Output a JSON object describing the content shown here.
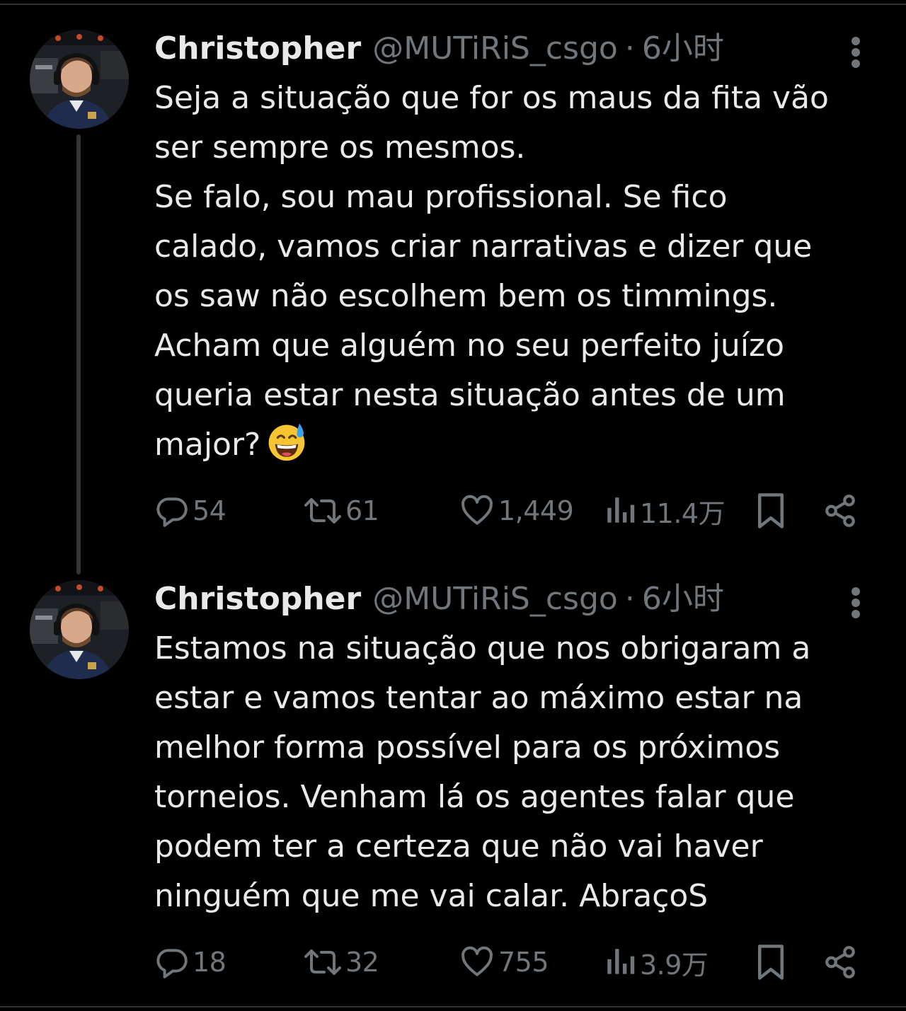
{
  "colors": {
    "background": "#000000",
    "text_primary": "#e7e9ea",
    "text_secondary": "#71767b",
    "thread_line": "#333639"
  },
  "tweets": [
    {
      "author": {
        "display_name": "Christopher",
        "handle": "@MUTiRiS_csgo",
        "separator": "·",
        "time": "6小时"
      },
      "text_lines": [
        "Seja a situação que for os maus da fita vão",
        "ser sempre os mesmos.",
        "Se falo, sou mau profissional. Se fico",
        "calado, vamos criar narrativas e dizer que",
        "os saw não escolhem bem os timmings.",
        "Acham que alguém no seu perfeito juízo",
        "queria estar nesta situação antes de um",
        "major?"
      ],
      "trailing_emoji": "grinning-face-with-sweat-emoji",
      "stats": {
        "replies": "54",
        "retweets": "61",
        "likes": "1,449",
        "views": "11.4万"
      }
    },
    {
      "author": {
        "display_name": "Christopher",
        "handle": "@MUTiRiS_csgo",
        "separator": "·",
        "time": "6小时"
      },
      "text_lines": [
        "Estamos na situação que nos obrigaram a",
        "estar e vamos tentar ao máximo estar na",
        "melhor forma possível para os próximos",
        "torneios. Venham lá os agentes falar que",
        "podem ter a certeza que não vai haver",
        "ninguém que me vai calar. AbraçoS"
      ],
      "stats": {
        "replies": "18",
        "retweets": "32",
        "likes": "755",
        "views": "3.9万"
      }
    }
  ],
  "icons": {
    "reply": "reply-icon",
    "retweet": "retweet-icon",
    "like": "heart-icon",
    "views": "views-icon",
    "bookmark": "bookmark-icon",
    "share": "share-icon",
    "more": "more-options-icon"
  }
}
